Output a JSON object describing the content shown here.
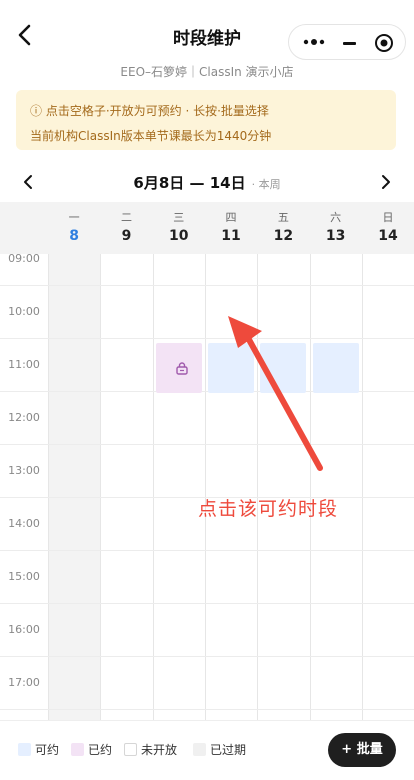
{
  "nav": {
    "title": "时段维护",
    "subtitle": "EEO–石箩婷｜ClassIn 演示小店"
  },
  "notice": {
    "line1": "ⓘ 点击空格子·开放为可预约 · 长按·批量选择",
    "line2": "当前机构ClassIn版本单节课最长为1440分钟"
  },
  "week": {
    "range": "6月8日 — 14日",
    "current": "· 本周"
  },
  "days": [
    {
      "weekday": "一",
      "date": "8",
      "today": true
    },
    {
      "weekday": "二",
      "date": "9"
    },
    {
      "weekday": "三",
      "date": "10"
    },
    {
      "weekday": "四",
      "date": "11"
    },
    {
      "weekday": "五",
      "date": "12"
    },
    {
      "weekday": "六",
      "date": "13"
    },
    {
      "weekday": "日",
      "date": "14"
    }
  ],
  "times": [
    "09:00",
    "10:00",
    "11:00",
    "12:00",
    "13:00",
    "14:00",
    "15:00",
    "16:00",
    "17:00"
  ],
  "slots": [
    {
      "day": "10",
      "time": "10:00",
      "status": "已约"
    },
    {
      "day": "11",
      "time": "10:00",
      "status": "可约"
    },
    {
      "day": "12",
      "time": "10:00",
      "status": "可约"
    },
    {
      "day": "13",
      "time": "10:00",
      "status": "可约"
    }
  ],
  "annotation": "点击该可约时段",
  "legend": {
    "available": "可约",
    "booked": "已约",
    "closed": "未开放",
    "expired": "已过期"
  },
  "batch_button": "+ 批量",
  "colors": {
    "available": "#e5efff",
    "booked": "#f3e3f5",
    "today": "#2f7fe0",
    "annotation": "#ee4a3c",
    "notice_bg": "#fdf4d9"
  },
  "icons": [
    "back-chevron-icon",
    "more-dots-icon",
    "minimize-icon",
    "close-target-icon",
    "chevron-left-icon",
    "chevron-right-icon",
    "lock-icon"
  ]
}
